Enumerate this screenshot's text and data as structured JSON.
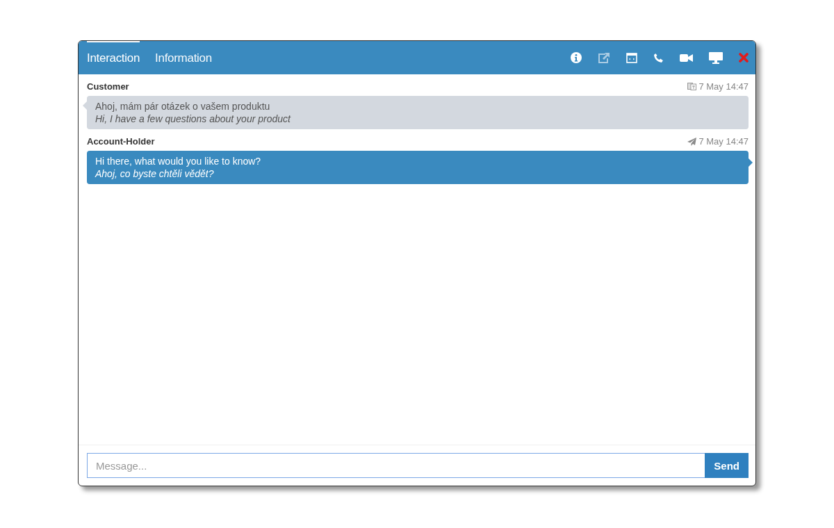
{
  "tabs": [
    {
      "label": "Interaction",
      "selected": true
    },
    {
      "label": "Information",
      "selected": false
    }
  ],
  "toolbar": [
    {
      "kind": "info"
    },
    {
      "kind": "popout"
    },
    {
      "kind": "browser"
    },
    {
      "kind": "phone"
    },
    {
      "kind": "video"
    },
    {
      "kind": "screen"
    },
    {
      "kind": "close"
    }
  ],
  "messages": [
    {
      "kind": "received",
      "sender": "Customer",
      "time": "7 May 14:47",
      "text": "Ahoj, mám pár otázek o vašem produktu",
      "translation": "Hi, I have a few questions about your product"
    },
    {
      "kind": "sent",
      "sender": "Account-Holder",
      "time": "7 May 14:47",
      "text": "Hi there, what would you like to know?",
      "translation": "Ahoj, co byste chtěli vědět?"
    }
  ],
  "composer": {
    "placeholder": "Message...",
    "button": "Send"
  }
}
